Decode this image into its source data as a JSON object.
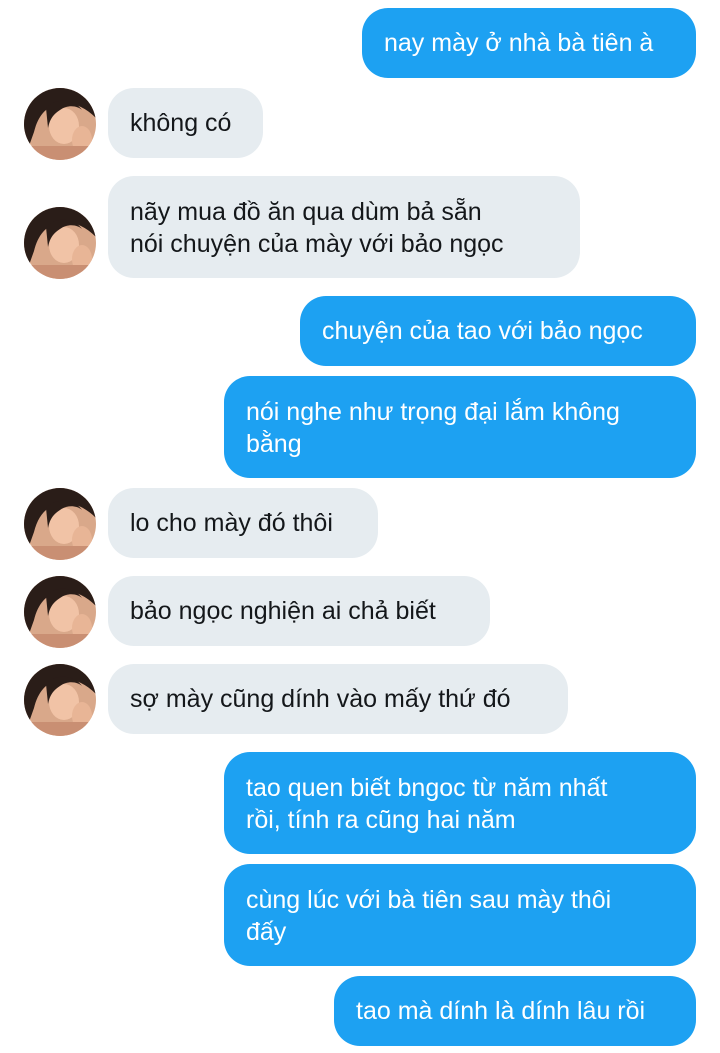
{
  "messages": [
    {
      "side": "out",
      "text": "nay mày ở nhà bà tiên à"
    },
    {
      "side": "in",
      "text": "không có"
    },
    {
      "side": "in",
      "lines": [
        "nãy mua đồ ăn qua dùm bả sẵn",
        "nói chuyện của mày với bảo ngọc"
      ]
    },
    {
      "side": "out",
      "text": "chuyện của tao với bảo ngọc"
    },
    {
      "side": "out",
      "lines": [
        "nói nghe như trọng đại lắm không",
        "bằng"
      ]
    },
    {
      "side": "in",
      "text": "lo cho mày đó thôi"
    },
    {
      "side": "in",
      "text": "bảo ngọc nghiện ai chả biết"
    },
    {
      "side": "in",
      "text": "sợ mày cũng dính vào mấy thứ đó"
    },
    {
      "side": "out",
      "lines": [
        "tao quen biết bngoc từ năm nhất",
        "rồi, tính ra cũng hai năm"
      ]
    },
    {
      "side": "out",
      "lines": [
        "cùng lúc với bà tiên sau mày thôi",
        "đấy"
      ]
    },
    {
      "side": "out",
      "text": "tao mà dính là dính lâu rồi"
    }
  ],
  "colors": {
    "outgoing_bubble": "#1da1f2",
    "incoming_bubble": "#e6ecf0",
    "outgoing_text": "#ffffff",
    "incoming_text": "#14171a"
  },
  "avatar_icon": "contact-avatar"
}
